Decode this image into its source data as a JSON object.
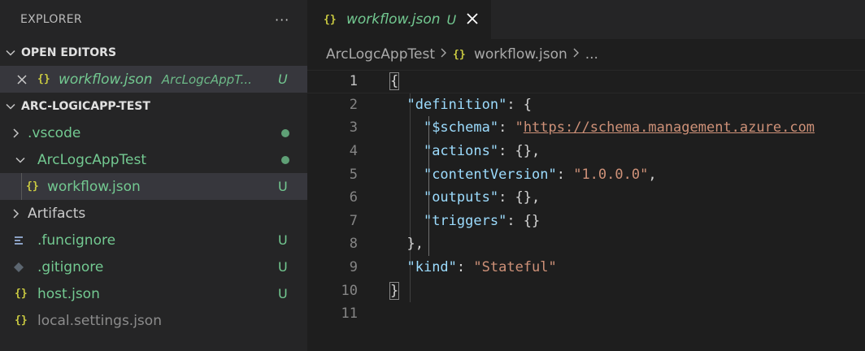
{
  "sidebar": {
    "title": "EXPLORER",
    "more_icon": "ellipsis-icon",
    "open_editors": {
      "heading": "OPEN EDITORS",
      "items": [
        {
          "name": "workflow.json",
          "path": "ArcLogcAppT...",
          "badge": "U"
        }
      ]
    },
    "project": {
      "heading": "ARC-LOGICAPP-TEST",
      "items": [
        {
          "name": ".vscode",
          "badge": ""
        },
        {
          "name": "ArcLogcAppTest",
          "badge": ""
        },
        {
          "name": "workflow.json",
          "badge": "U"
        },
        {
          "name": "Artifacts",
          "badge": ""
        },
        {
          "name": ".funcignore",
          "badge": "U"
        },
        {
          "name": ".gitignore",
          "badge": "U"
        },
        {
          "name": "host.json",
          "badge": "U"
        },
        {
          "name": "local.settings.json",
          "badge": ""
        }
      ]
    }
  },
  "editor": {
    "tab": {
      "name": "workflow.json",
      "badge": "U",
      "json_glyph": "{}"
    },
    "breadcrumb": {
      "folder": "ArcLogcAppTest",
      "file": "workflow.json",
      "more": "..."
    },
    "lines": [
      "1",
      "2",
      "3",
      "4",
      "5",
      "6",
      "7",
      "8",
      "9",
      "10",
      "11"
    ],
    "code": {
      "definition_key": "\"definition\"",
      "schema_key": "\"$schema\"",
      "schema_value": "https://schema.management.azure.com",
      "actions_key": "\"actions\"",
      "contentVersion_key": "\"contentVersion\"",
      "contentVersion_value": "\"1.0.0.0\"",
      "outputs_key": "\"outputs\"",
      "triggers_key": "\"triggers\"",
      "kind_key": "\"kind\"",
      "kind_value": "\"Stateful\""
    }
  },
  "colors": {
    "untracked": "#73c991",
    "json_icon": "#cbcb41",
    "json_key": "#9cdcfe",
    "json_string": "#ce9178"
  }
}
